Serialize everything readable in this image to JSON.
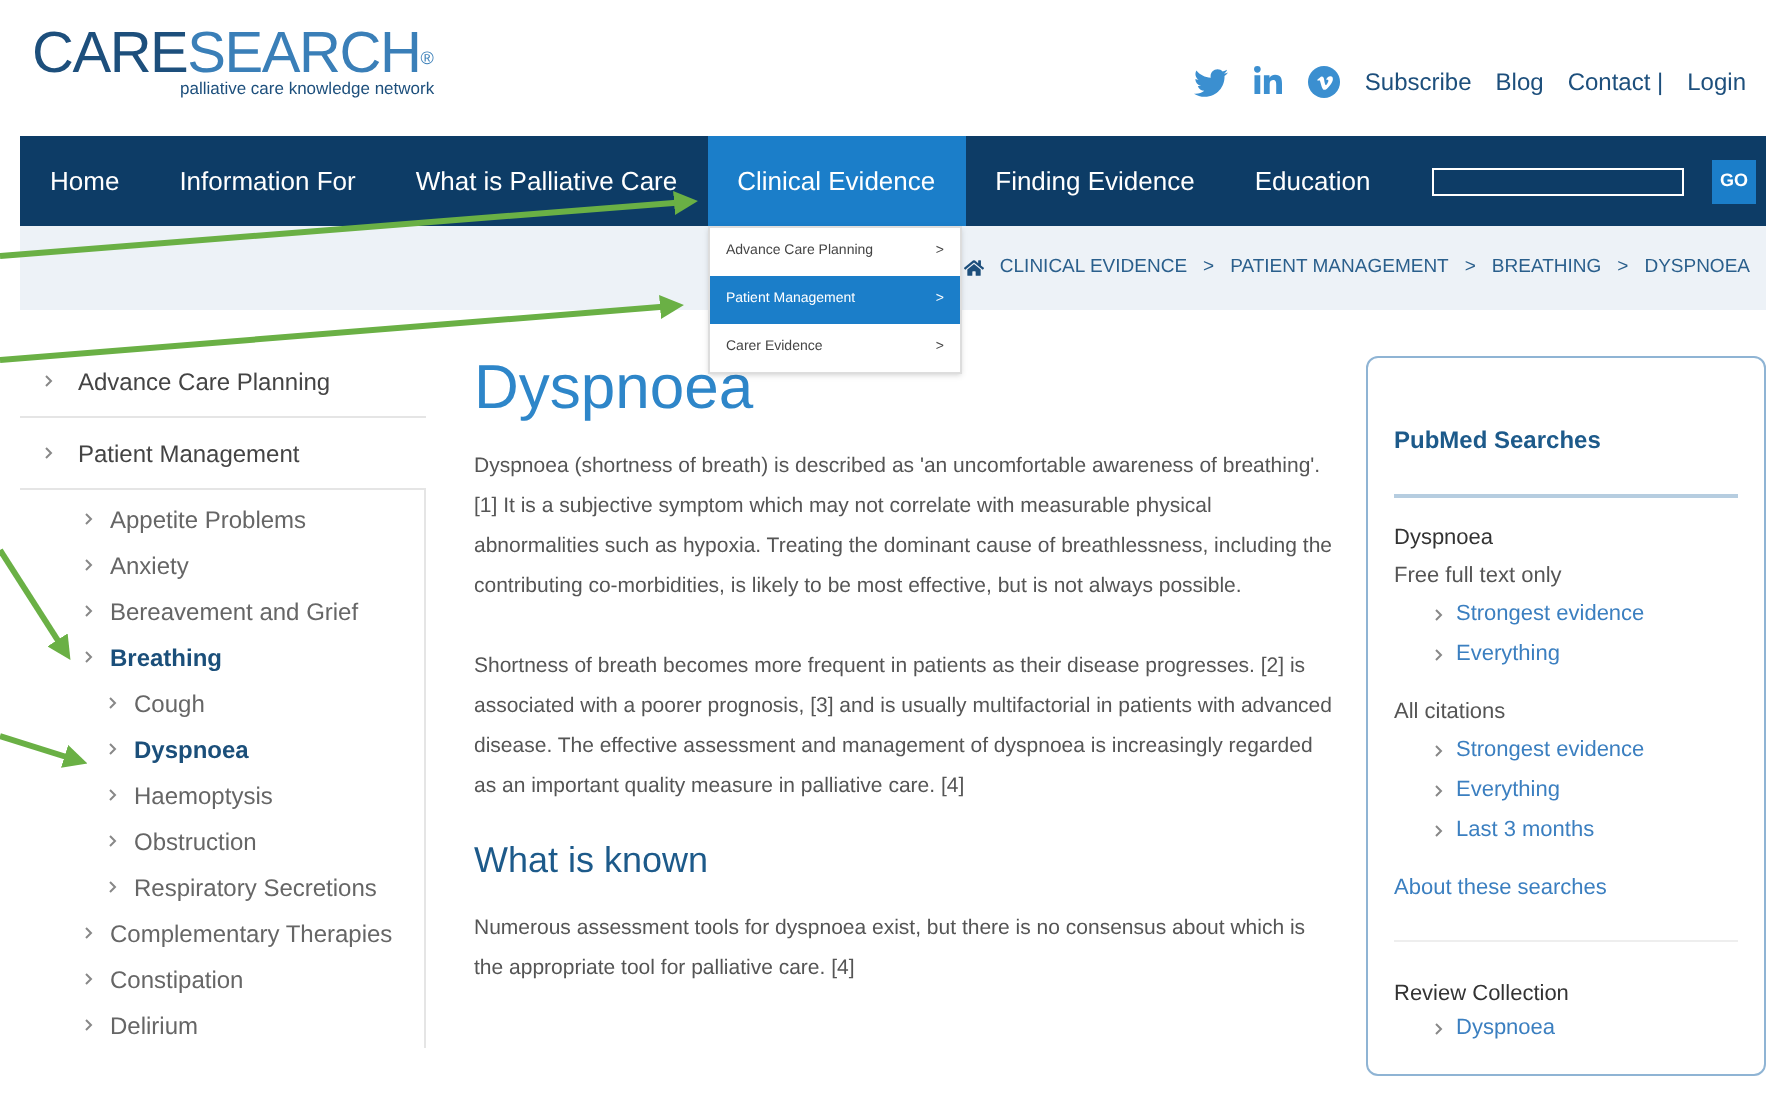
{
  "logo": {
    "part_1": "CARE",
    "part_2": "SEARCH",
    "mark": "®",
    "tagline": "palliative care knowledge network"
  },
  "top_links": [
    "Subscribe",
    "Blog",
    "Contact |",
    "Login"
  ],
  "nav": {
    "items": [
      {
        "label": "Home",
        "selected": false
      },
      {
        "label": "Information For",
        "selected": false
      },
      {
        "label": "What is Palliative Care",
        "selected": false
      },
      {
        "label": "Clinical Evidence",
        "selected": true
      },
      {
        "label": "Finding Evidence",
        "selected": false
      },
      {
        "label": "Education",
        "selected": false
      }
    ],
    "search_button": "GO"
  },
  "dropdown": [
    {
      "label": "Advance Care Planning",
      "arrow": ">",
      "selected": false
    },
    {
      "label": "Patient Management",
      "arrow": ">",
      "selected": true
    },
    {
      "label": "Carer Evidence",
      "arrow": ">",
      "selected": false
    }
  ],
  "breadcrumb": [
    "CLINICAL EVIDENCE",
    ">",
    "PATIENT MANAGEMENT",
    ">",
    "BREATHING",
    ">",
    "DYSPNOEA"
  ],
  "sidebar": {
    "items": [
      {
        "label": "Advance Care Planning",
        "selected": false
      },
      {
        "label": "Patient Management",
        "selected": false,
        "children": [
          {
            "label": "Appetite Problems",
            "selected": false
          },
          {
            "label": "Anxiety",
            "selected": false
          },
          {
            "label": "Bereavement and Grief",
            "selected": false
          },
          {
            "label": "Breathing",
            "selected": true,
            "children": [
              {
                "label": "Cough",
                "selected": false
              },
              {
                "label": "Dyspnoea",
                "selected": true
              },
              {
                "label": "Haemoptysis",
                "selected": false
              },
              {
                "label": "Obstruction",
                "selected": false
              },
              {
                "label": "Respiratory Secretions",
                "selected": false
              }
            ]
          },
          {
            "label": "Complementary Therapies",
            "selected": false
          },
          {
            "label": "Constipation",
            "selected": false
          },
          {
            "label": "Delirium",
            "selected": false
          }
        ]
      }
    ]
  },
  "article": {
    "title": "Dyspnoea",
    "paragraphs": [
      "Dyspnoea (shortness of breath) is described as 'an uncomfortable awareness of breathing'. [1] It is a subjective symptom which may not correlate with measurable physical abnormalities such as hypoxia. Treating the dominant cause of breathlessness, including the contributing co-morbidities, is likely to be most effective, but is not always possible.",
      "Shortness of breath becomes more frequent in patients as their disease progresses. [2] is associated with a poorer prognosis, [3] and is usually multifactorial in patients with advanced disease. The effective assessment and management of dyspnoea is increasingly regarded as an important quality measure in palliative care. [4]"
    ],
    "subheading": "What is known",
    "subparagraph": "Numerous assessment tools for dyspnoea exist, but there is no consensus about which is the appropriate tool for palliative care. [4]"
  },
  "pubmed": {
    "title": "PubMed Searches",
    "topic": "Dyspnoea",
    "groups": [
      {
        "label": "Free full text only",
        "links": [
          "Strongest evidence",
          "Everything"
        ]
      },
      {
        "label": "All citations",
        "links": [
          "Strongest evidence",
          "Everything",
          "Last 3 months"
        ]
      }
    ],
    "about": "About these searches",
    "review_title": "Review Collection",
    "review_links": [
      "Dyspnoea"
    ]
  }
}
